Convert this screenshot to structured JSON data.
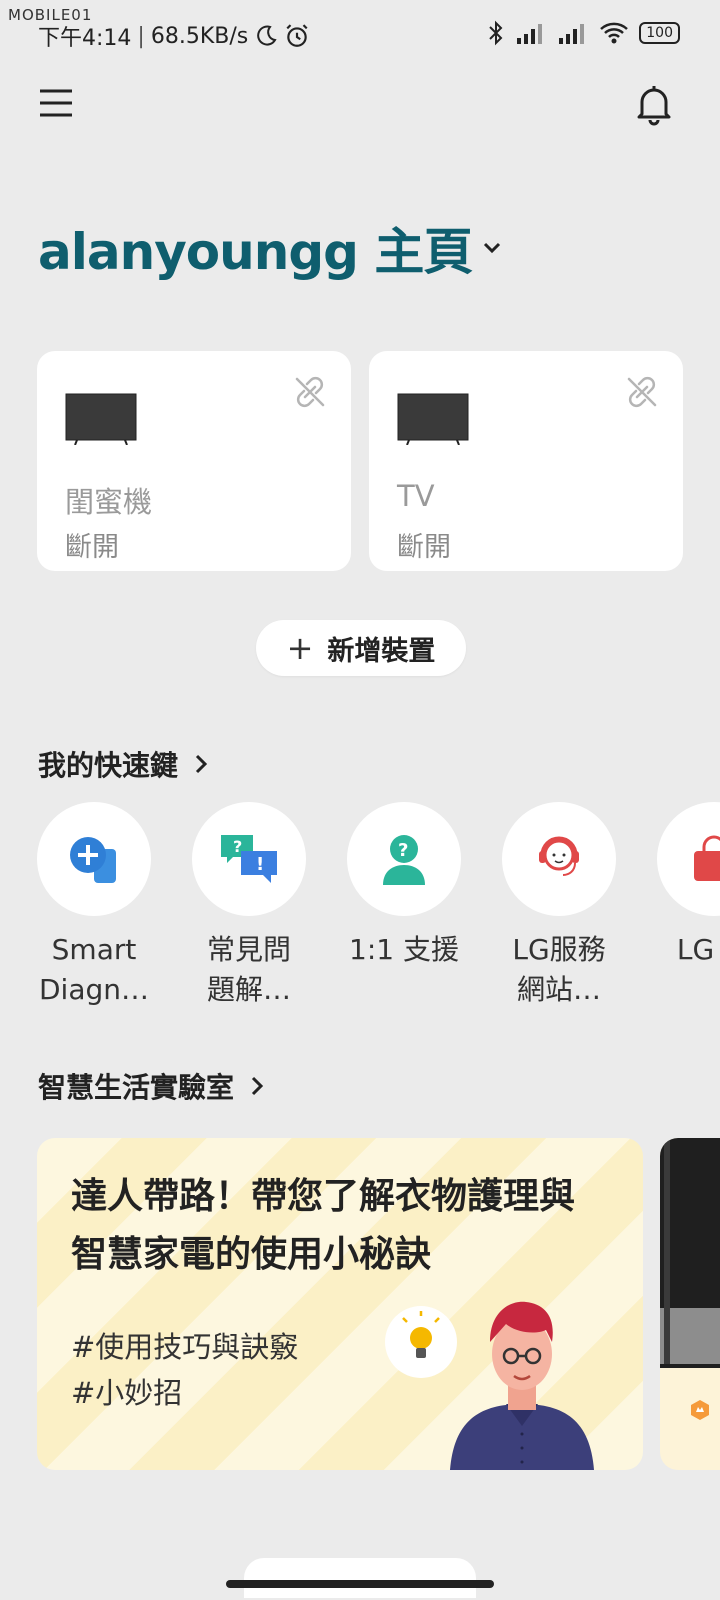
{
  "watermark": "MOBILE01",
  "status_bar": {
    "time": "下午4:14",
    "speed": "68.5KB/s",
    "battery": "100",
    "icons": [
      "moon-icon",
      "alarm-icon",
      "bluetooth-icon",
      "signal-icon",
      "signal-icon",
      "wifi-icon",
      "battery-icon"
    ]
  },
  "header": {
    "menu_icon": "hamburger-menu-icon",
    "bell_icon": "bell-icon"
  },
  "home": {
    "title": "alanyoungg 主頁",
    "dropdown_icon": "chevron-down-icon"
  },
  "devices": [
    {
      "name": "閨蜜機",
      "status": "斷開",
      "icon": "tv-icon",
      "status_icon": "unlink-icon"
    },
    {
      "name": "TV",
      "status": "斷開",
      "icon": "tv-icon",
      "status_icon": "unlink-icon"
    }
  ],
  "add_device": {
    "label": "新增裝置",
    "icon": "plus-icon"
  },
  "shortcuts_section": {
    "title": "我的快速鍵",
    "items": [
      {
        "label": "Smart\nDiagn…",
        "icon": "smart-diagnosis-icon"
      },
      {
        "label": "常見問\n題解…",
        "icon": "faq-chat-icon"
      },
      {
        "label": "1:1 支援",
        "icon": "support-person-icon"
      },
      {
        "label": "LG服務\n網站…",
        "icon": "headset-agent-icon"
      },
      {
        "label": "LG 商",
        "icon": "shopping-bag-icon"
      }
    ]
  },
  "lab_section": {
    "title": "智慧生活實驗室",
    "cards": [
      {
        "headline": "達人帶路！帶您了解衣物護理與智慧家電的使用小秘訣",
        "tags": [
          "#使用技巧與訣竅",
          "#小妙招"
        ]
      }
    ]
  },
  "colors": {
    "accent": "#0f5e6e",
    "background": "#ebebeb",
    "card": "#ffffff",
    "lab_card": "#fdf7df"
  }
}
